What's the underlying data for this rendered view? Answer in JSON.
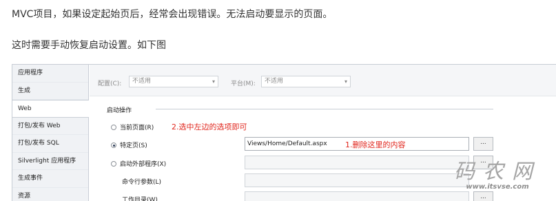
{
  "article": {
    "line1": "MVC项目，如果设定起始页后，经常会出现错误。无法启动要显示的页面。",
    "line2": "这时需要手动恢复启动设置。如下图"
  },
  "sidebar": {
    "items": [
      {
        "label": "应用程序"
      },
      {
        "label": "生成"
      },
      {
        "label": "Web",
        "selected": true
      },
      {
        "label": "打包/发布 Web"
      },
      {
        "label": "打包/发布 SQL"
      },
      {
        "label": "Silverlight 应用程序"
      },
      {
        "label": "生成事件"
      },
      {
        "label": "资源"
      }
    ]
  },
  "config": {
    "config_label": "配置(C):",
    "config_value": "不适用",
    "platform_label": "平台(M):",
    "platform_value": "不适用"
  },
  "start_action": {
    "group_title": "启动操作",
    "current_page_label": "当前页面(R)",
    "specific_page_label": "特定页(S)",
    "specific_page_value": "Views/Home/Default.aspx",
    "external_program_label": "启动外部程序(X)",
    "command_args_label": "命令行参数(L)",
    "working_dir_label": "工作目录(W)",
    "browse_label": "..."
  },
  "annotations": {
    "select_left": "2.选中左边的选项即可",
    "delete_here": "1.删除这里的内容"
  },
  "watermark": {
    "logo_text": "码农网",
    "url": "www.itsvse.com"
  },
  "colors": {
    "annotation_red": "#e0241b",
    "sidebar_bg": "#f0f2f5",
    "config_bar_bg": "#f5f6f8"
  }
}
